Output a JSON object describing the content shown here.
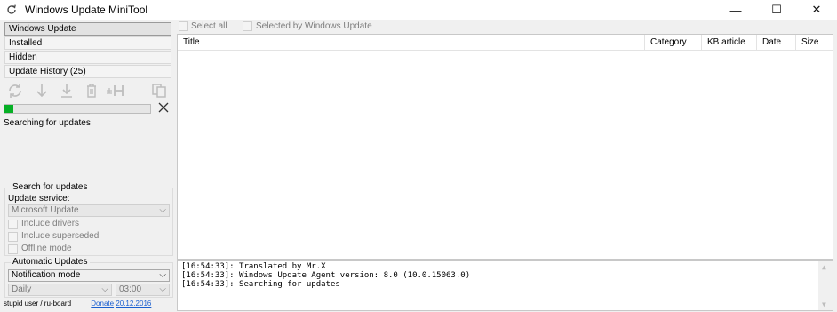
{
  "window": {
    "title": "Windows Update MiniTool",
    "minimize_glyph": "—",
    "maximize_glyph": "☐",
    "close_glyph": "✕"
  },
  "nav": {
    "items": [
      {
        "label": "Windows Update",
        "active": true
      },
      {
        "label": "Installed",
        "active": false
      },
      {
        "label": "Hidden",
        "active": false
      },
      {
        "label": "Update History (25)",
        "active": false
      }
    ]
  },
  "toolbar": {
    "icons": [
      "refresh-icon",
      "download-icon",
      "install-icon",
      "delete-icon",
      "hide-icon",
      "copy-icon"
    ]
  },
  "progress": {
    "fraction": 0.06,
    "color": "#06b025"
  },
  "status": {
    "text": "Searching for updates"
  },
  "search_group": {
    "legend": "Search for updates",
    "service_label": "Update service:",
    "service_value": "Microsoft Update",
    "include_drivers": "Include drivers",
    "include_superseded": "Include superseded",
    "offline_mode": "Offline mode"
  },
  "auto_group": {
    "legend": "Automatic Updates",
    "mode_value": "Notification mode",
    "schedule_day": "Daily",
    "schedule_time": "03:00"
  },
  "footer": {
    "credit": "stupid user / ru-board",
    "donate": "Donate",
    "date": "20.12.2016"
  },
  "selection": {
    "select_all": "Select all",
    "selected_by_wu": "Selected by Windows Update"
  },
  "table": {
    "columns": [
      "Title",
      "Category",
      "KB article",
      "Date",
      "Size"
    ]
  },
  "log": {
    "lines": [
      "[16:54:33]: Translated by Mr.X",
      "[16:54:33]: Windows Update Agent version: 8.0 (10.0.15063.0)",
      "[16:54:33]: Searching for updates"
    ]
  }
}
